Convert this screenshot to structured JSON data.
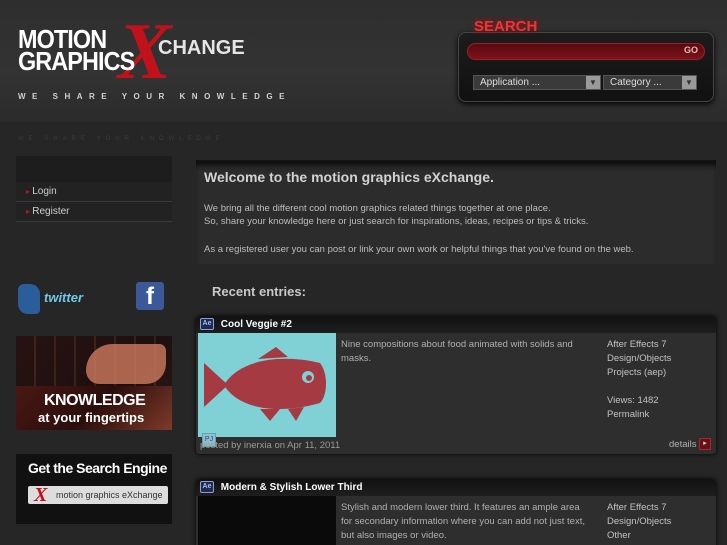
{
  "brand": {
    "line1": "MOTION",
    "line2": "GRAPHICS",
    "x": "X",
    "change": "CHANGE",
    "tagline": "WE SHARE YOUR KNOWLEDGE"
  },
  "search": {
    "title": "SEARCH",
    "go_label": "GO",
    "input_value": "",
    "application_select": "Application ...",
    "category_select": "Category ..."
  },
  "nav": {
    "login": "Login",
    "register": "Register"
  },
  "social": {
    "twitter": "twitter",
    "facebook": "f"
  },
  "banners": {
    "knowledge_line1": "KNOWLEDGE",
    "knowledge_line2": "at your fingertips",
    "search_title": "Get the Search Engine",
    "search_x": "X",
    "search_text": "motion graphics eXchange"
  },
  "welcome": {
    "title": "Welcome to the motion graphics eXchange.",
    "p1": "We bring all the different cool motion graphics related things together at one place.",
    "p2": "So, share your knowledge here or just search for inspirations, ideas, recipes or tips & tricks.",
    "p3": "As a registered user you can post or link your own work or helpful things that you've found on the web."
  },
  "recent_title": "Recent entries:",
  "entries": [
    {
      "icon": "Ae",
      "title": "Cool Veggie #2",
      "desc": "Nine compositions about food animated with solids and masks.",
      "app": "After Effects 7",
      "category": "Design/Objects",
      "type": "Projects (aep)",
      "views": "Views: 1482",
      "permalink": "Permalink",
      "posted": "posted by inerxia on Apr 11, 2011",
      "details": "details",
      "thumb_color": "#7fd1d5",
      "fish_color": "#a53a42"
    },
    {
      "icon": "Ae",
      "title": "Modern & Stylish Lower Third",
      "desc": "Stylish and modern lower third. It features an ample area for secondary information where you can add not just text, but also images or video.",
      "app": "After Effects 7",
      "category": "Design/Objects",
      "type": "Other"
    }
  ]
}
